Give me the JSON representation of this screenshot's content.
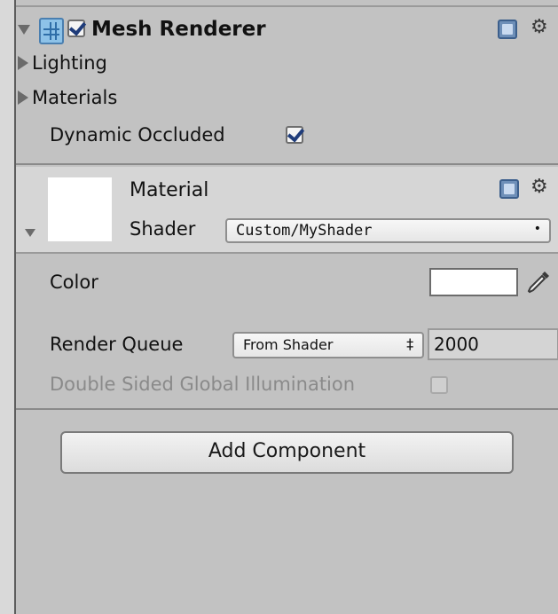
{
  "mesh_renderer": {
    "title": "Mesh Renderer",
    "enabled": true,
    "lighting_label": "Lighting",
    "materials_label": "Materials",
    "dynamic_occluded_label": "Dynamic Occluded",
    "dynamic_occluded_checked": true
  },
  "material": {
    "title": "Material",
    "shader_label": "Shader",
    "shader_value": "Custom/MyShader",
    "color_label": "Color",
    "color_value": "#ffffff",
    "render_queue_label": "Render Queue",
    "render_queue_mode": "From Shader",
    "render_queue_value": "2000",
    "double_sided_gi_label": "Double Sided Global Illumination",
    "double_sided_gi_checked": false
  },
  "add_component_label": "Add Component",
  "icons": {
    "fold": "triangle-down",
    "collapsed": "triangle-right",
    "mesh": "mesh-renderer-icon",
    "help": "help-icon",
    "settings": "gear-icon",
    "eyedropper": "eyedropper-icon"
  }
}
